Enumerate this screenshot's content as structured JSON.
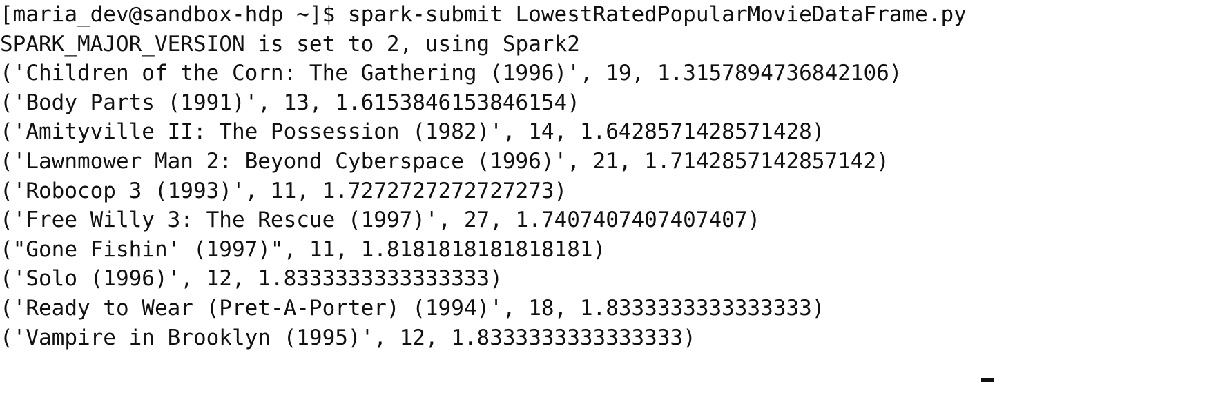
{
  "terminal": {
    "prompt": "[maria_dev@sandbox-hdp ~]$ spark-submit LowestRatedPopularMovieDataFrame.py",
    "lines": [
      "SPARK_MAJOR_VERSION is set to 2, using Spark2",
      "('Children of the Corn: The Gathering (1996)', 19, 1.3157894736842106)",
      "('Body Parts (1991)', 13, 1.6153846153846154)",
      "('Amityville II: The Possession (1982)', 14, 1.6428571428571428)",
      "('Lawnmower Man 2: Beyond Cyberspace (1996)', 21, 1.7142857142857142)",
      "('Robocop 3 (1993)', 11, 1.7272727272727273)",
      "('Free Willy 3: The Rescue (1997)', 27, 1.7407407407407407)",
      "(\"Gone Fishin' (1997)\", 11, 1.8181818181818181)",
      "('Solo (1996)', 12, 1.8333333333333333)",
      "('Ready to Wear (Pret-A-Porter) (1994)', 18, 1.8333333333333333)",
      "('Vampire in Brooklyn (1995)', 12, 1.8333333333333333)"
    ]
  }
}
